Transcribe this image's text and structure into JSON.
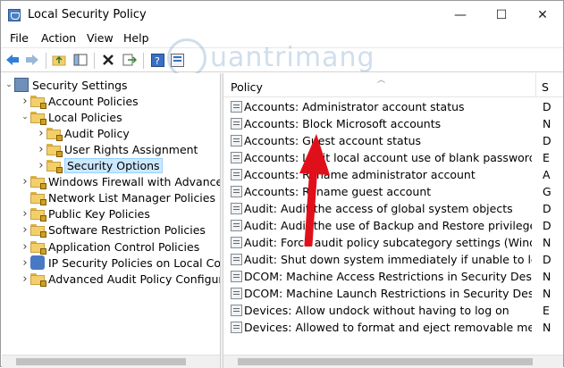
{
  "window": {
    "title": "Local Security Policy",
    "minimize": "—",
    "maximize": "☐",
    "close": "✕"
  },
  "menu": [
    "File",
    "Action",
    "View",
    "Help"
  ],
  "watermark": "uantrimang",
  "tree": [
    {
      "label": "Security Settings",
      "icon": "security-settings-icon",
      "indent": 0,
      "arrow": "down"
    },
    {
      "label": "Account Policies",
      "icon": "folder-icon",
      "indent": 1,
      "arrow": "right"
    },
    {
      "label": "Local Policies",
      "icon": "folder-icon",
      "indent": 1,
      "arrow": "down"
    },
    {
      "label": "Audit Policy",
      "icon": "folder-icon",
      "indent": 2,
      "arrow": "right"
    },
    {
      "label": "User Rights Assignment",
      "icon": "folder-icon",
      "indent": 2,
      "arrow": "right"
    },
    {
      "label": "Security Options",
      "icon": "folder-icon",
      "indent": 2,
      "arrow": "right",
      "selected": true
    },
    {
      "label": "Windows Firewall with Advanced Secu",
      "icon": "folder-icon",
      "indent": 1,
      "arrow": "right"
    },
    {
      "label": "Network List Manager Policies",
      "icon": "folder-icon",
      "indent": 1,
      "arrow": ""
    },
    {
      "label": "Public Key Policies",
      "icon": "folder-icon",
      "indent": 1,
      "arrow": "right"
    },
    {
      "label": "Software Restriction Policies",
      "icon": "folder-icon",
      "indent": 1,
      "arrow": "right"
    },
    {
      "label": "Application Control Policies",
      "icon": "folder-icon",
      "indent": 1,
      "arrow": "right"
    },
    {
      "label": "IP Security Policies on Local Compute",
      "icon": "ip-security-icon",
      "indent": 1,
      "arrow": "right"
    },
    {
      "label": "Advanced Audit Policy Configuration",
      "icon": "folder-icon",
      "indent": 1,
      "arrow": "right"
    }
  ],
  "list": {
    "columns": [
      "Policy",
      "S"
    ],
    "rows": [
      {
        "policy": "Accounts: Administrator account status",
        "setting": "D"
      },
      {
        "policy": "Accounts: Block Microsoft accounts",
        "setting": "N"
      },
      {
        "policy": "Accounts: Guest account status",
        "setting": "D"
      },
      {
        "policy": "Accounts: Limit local account use of blank passwords to co...",
        "setting": "E"
      },
      {
        "policy": "Accounts: Rename administrator account",
        "setting": "A"
      },
      {
        "policy": "Accounts: Rename guest account",
        "setting": "G"
      },
      {
        "policy": "Audit: Audit the access of global system objects",
        "setting": "D"
      },
      {
        "policy": "Audit: Audit the use of Backup and Restore privilege",
        "setting": "D"
      },
      {
        "policy": "Audit: Force audit policy subcategory settings (Windows Vis...",
        "setting": "N"
      },
      {
        "policy": "Audit: Shut down system immediately if unable to log secur...",
        "setting": "D"
      },
      {
        "policy": "DCOM: Machine Access Restrictions in Security Descriptor D...",
        "setting": "N"
      },
      {
        "policy": "DCOM: Machine Launch Restrictions in Security Descriptor ...",
        "setting": "N"
      },
      {
        "policy": "Devices: Allow undock without having to log on",
        "setting": "E"
      },
      {
        "policy": "Devices: Allowed to format and eject removable media",
        "setting": "N"
      }
    ]
  },
  "colors": {
    "selection": "#cce8ff",
    "arrow": "#e0101a",
    "folder": "#f3cf6b"
  }
}
